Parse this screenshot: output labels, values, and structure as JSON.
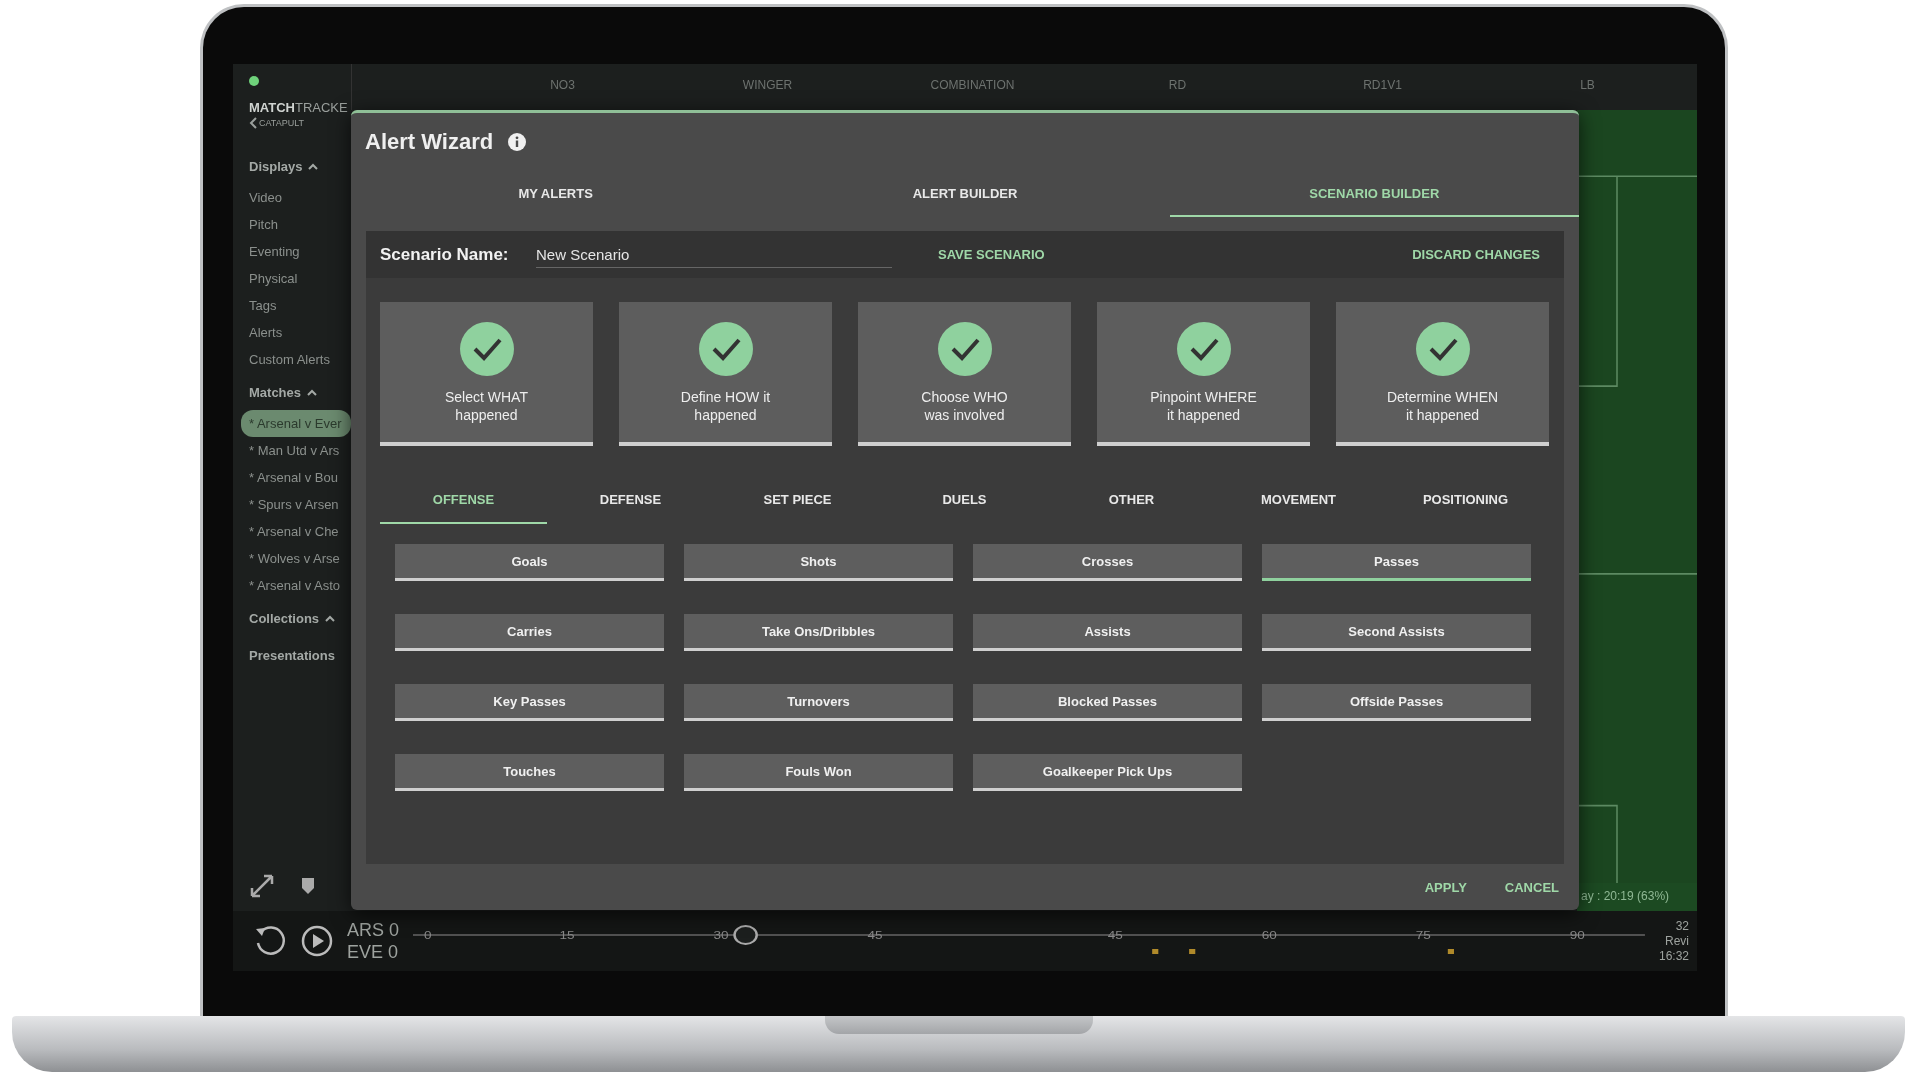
{
  "brand": {
    "name": "**MATCH**TRACKE",
    "company": "CATAPULT"
  },
  "sidebar": {
    "sections": [
      {
        "title": "Displays",
        "expanded": true,
        "items": [
          {
            "label": "Video",
            "selected": false
          },
          {
            "label": "Pitch",
            "selected": false
          },
          {
            "label": "Eventing",
            "selected": false
          },
          {
            "label": "Physical",
            "selected": false
          },
          {
            "label": "Tags",
            "selected": false
          },
          {
            "label": "Alerts",
            "selected": false
          },
          {
            "label": "Custom Alerts",
            "selected": false
          }
        ]
      },
      {
        "title": "Matches",
        "expanded": true,
        "items": [
          {
            "label": "* Arsenal v Ever",
            "selected": true
          },
          {
            "label": "* Man Utd v Ars",
            "selected": false
          },
          {
            "label": "* Arsenal v Bou",
            "selected": false
          },
          {
            "label": "* Spurs v Arsen",
            "selected": false
          },
          {
            "label": "* Arsenal v Che",
            "selected": false
          },
          {
            "label": "* Wolves v Arse",
            "selected": false
          },
          {
            "label": "* Arsenal v Asto",
            "selected": false
          }
        ]
      },
      {
        "title": "Collections",
        "expanded": true
      },
      {
        "title": "Presentations"
      }
    ]
  },
  "top_bar": {
    "labels": [
      "NO3",
      "WINGER",
      "COMBINATION",
      "RD",
      "RD1V1",
      "LB"
    ]
  },
  "modal": {
    "title": "Alert Wizard",
    "tabs": [
      {
        "label": "MY ALERTS",
        "selected": false
      },
      {
        "label": "ALERT BUILDER",
        "selected": false
      },
      {
        "label": "SCENARIO BUILDER",
        "selected": true
      }
    ],
    "scenario": {
      "label": "Scenario Name:",
      "value": "New Scenario",
      "actions": [
        "SAVE SCENARIO",
        "DISCARD CHANGES"
      ]
    },
    "steps": [
      {
        "text": "Select WHAT\nhappened",
        "completed": true
      },
      {
        "text": "Define HOW it\nhappened",
        "completed": true
      },
      {
        "text": "Choose WHO\nwas involved",
        "completed": true
      },
      {
        "text": "Pinpoint WHERE\nit happened",
        "completed": true
      },
      {
        "text": "Determine WHEN\nit happened",
        "completed": true
      }
    ],
    "categories": [
      {
        "label": "OFFENSE",
        "selected": true
      },
      {
        "label": "DEFENSE",
        "selected": false
      },
      {
        "label": "SET PIECE",
        "selected": false
      },
      {
        "label": "DUELS",
        "selected": false
      },
      {
        "label": "OTHER",
        "selected": false
      },
      {
        "label": "MOVEMENT",
        "selected": false
      },
      {
        "label": "POSITIONING",
        "selected": false
      }
    ],
    "events": [
      {
        "label": "Goals",
        "selected": false
      },
      {
        "label": "Shots",
        "selected": false
      },
      {
        "label": "Crosses",
        "selected": false
      },
      {
        "label": "Passes",
        "selected": true
      },
      {
        "label": "Carries",
        "selected": false
      },
      {
        "label": "Take Ons/Dribbles",
        "selected": false
      },
      {
        "label": "Assists",
        "selected": false
      },
      {
        "label": "Second Assists",
        "selected": false
      },
      {
        "label": "Key Passes",
        "selected": false
      },
      {
        "label": "Turnovers",
        "selected": false
      },
      {
        "label": "Blocked Passes",
        "selected": false
      },
      {
        "label": "Offside Passes",
        "selected": false
      },
      {
        "label": "Touches",
        "selected": false
      },
      {
        "label": "Fouls Won",
        "selected": false
      },
      {
        "label": "Goalkeeper Pick Ups",
        "selected": false
      }
    ],
    "footer": [
      "APPLY",
      "CANCEL"
    ]
  },
  "pitch": {
    "caption": "ay : 20:19 (63%)"
  },
  "playback": {
    "scores": [
      "ARS 0",
      "EVE 0"
    ],
    "timeline": {
      "ticks": [
        "0",
        "15",
        "30",
        "45",
        "45",
        "60",
        "75",
        "90"
      ],
      "level": 0.27
    },
    "info": [
      "32",
      "Revi",
      "16:32"
    ]
  }
}
